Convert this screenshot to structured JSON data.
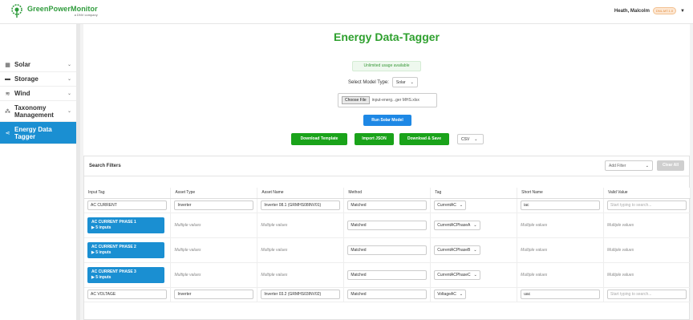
{
  "header": {
    "brand": "GreenPowerMonitor",
    "brand_sub": "a DNV company",
    "user_name": "Heath, Malcolm",
    "user_badge": "DNL.MT.1.0"
  },
  "sidebar": {
    "items": [
      {
        "label": "Solar",
        "icon": "solar-panel-icon"
      },
      {
        "label": "Storage",
        "icon": "battery-icon"
      },
      {
        "label": "Wind",
        "icon": "wind-icon"
      },
      {
        "label": "Taxonomy Management",
        "icon": "hierarchy-icon"
      },
      {
        "label": "Energy Data Tagger",
        "icon": "share-icon"
      }
    ]
  },
  "main": {
    "title": "Energy Data-Tagger",
    "usage_notice": "Unlimited usage available",
    "model_type_label": "Select Model Type:",
    "model_type_value": "Solar",
    "file_button": "Choose File",
    "file_name": "input-energ...ger MHS.xlsx",
    "run_button": "Run Solar Model",
    "download_template": "Download Template",
    "import_json": "Import JSON",
    "download_save": "Download & Save",
    "format_value": "CSV"
  },
  "filters": {
    "label": "Search Filters",
    "add_filter": "Add Filter",
    "clear_all": "Clear All"
  },
  "table": {
    "columns": [
      "Input Tag",
      "Asset Type",
      "Asset Name",
      "Method",
      "Tag",
      "Short Name",
      "Valid Value"
    ],
    "placeholder_valid": "Start typing to search...",
    "rows": [
      {
        "kind": "single",
        "input_tag": "AC CURRENT",
        "asset_type": "Inverter",
        "asset_name": "Inverter 08.1 (GRMHS08INV01)",
        "method": "Matched",
        "tag": "CurrentAC",
        "short_name": "iac"
      },
      {
        "kind": "group",
        "input_tag": "AC CURRENT PHASE 1",
        "inputs": "▶ 5 inputs",
        "asset_type": "Multiple values",
        "asset_name": "Multiple values",
        "method": "Matched",
        "tag": "CurrentACPhaseA",
        "short_name": "Multiple values",
        "valid": "Multiple values"
      },
      {
        "kind": "group",
        "input_tag": "AC CURRENT PHASE 2",
        "inputs": "▶ 5 inputs",
        "asset_type": "Multiple values",
        "asset_name": "Multiple values",
        "method": "Matched",
        "tag": "CurrentACPhaseB",
        "short_name": "Multiple values",
        "valid": "Multiple values"
      },
      {
        "kind": "group",
        "input_tag": "AC CURRENT PHASE 3",
        "inputs": "▶ 5 inputs",
        "asset_type": "Multiple values",
        "asset_name": "Multiple values",
        "method": "Matched",
        "tag": "CurrentACPhaseC",
        "short_name": "Multiple values",
        "valid": "Multiple values"
      },
      {
        "kind": "single",
        "input_tag": "AC VOLTAGE",
        "asset_type": "Inverter",
        "asset_name": "Inverter 03.2 (GRMHS03INV02)",
        "method": "Matched",
        "tag": "VoltageAC",
        "short_name": "uac"
      }
    ]
  },
  "colors": {
    "brand_green": "#2ea02e",
    "action_blue": "#1e88e5",
    "sidebar_active": "#1a8fd2",
    "button_green": "#1aa31a"
  }
}
